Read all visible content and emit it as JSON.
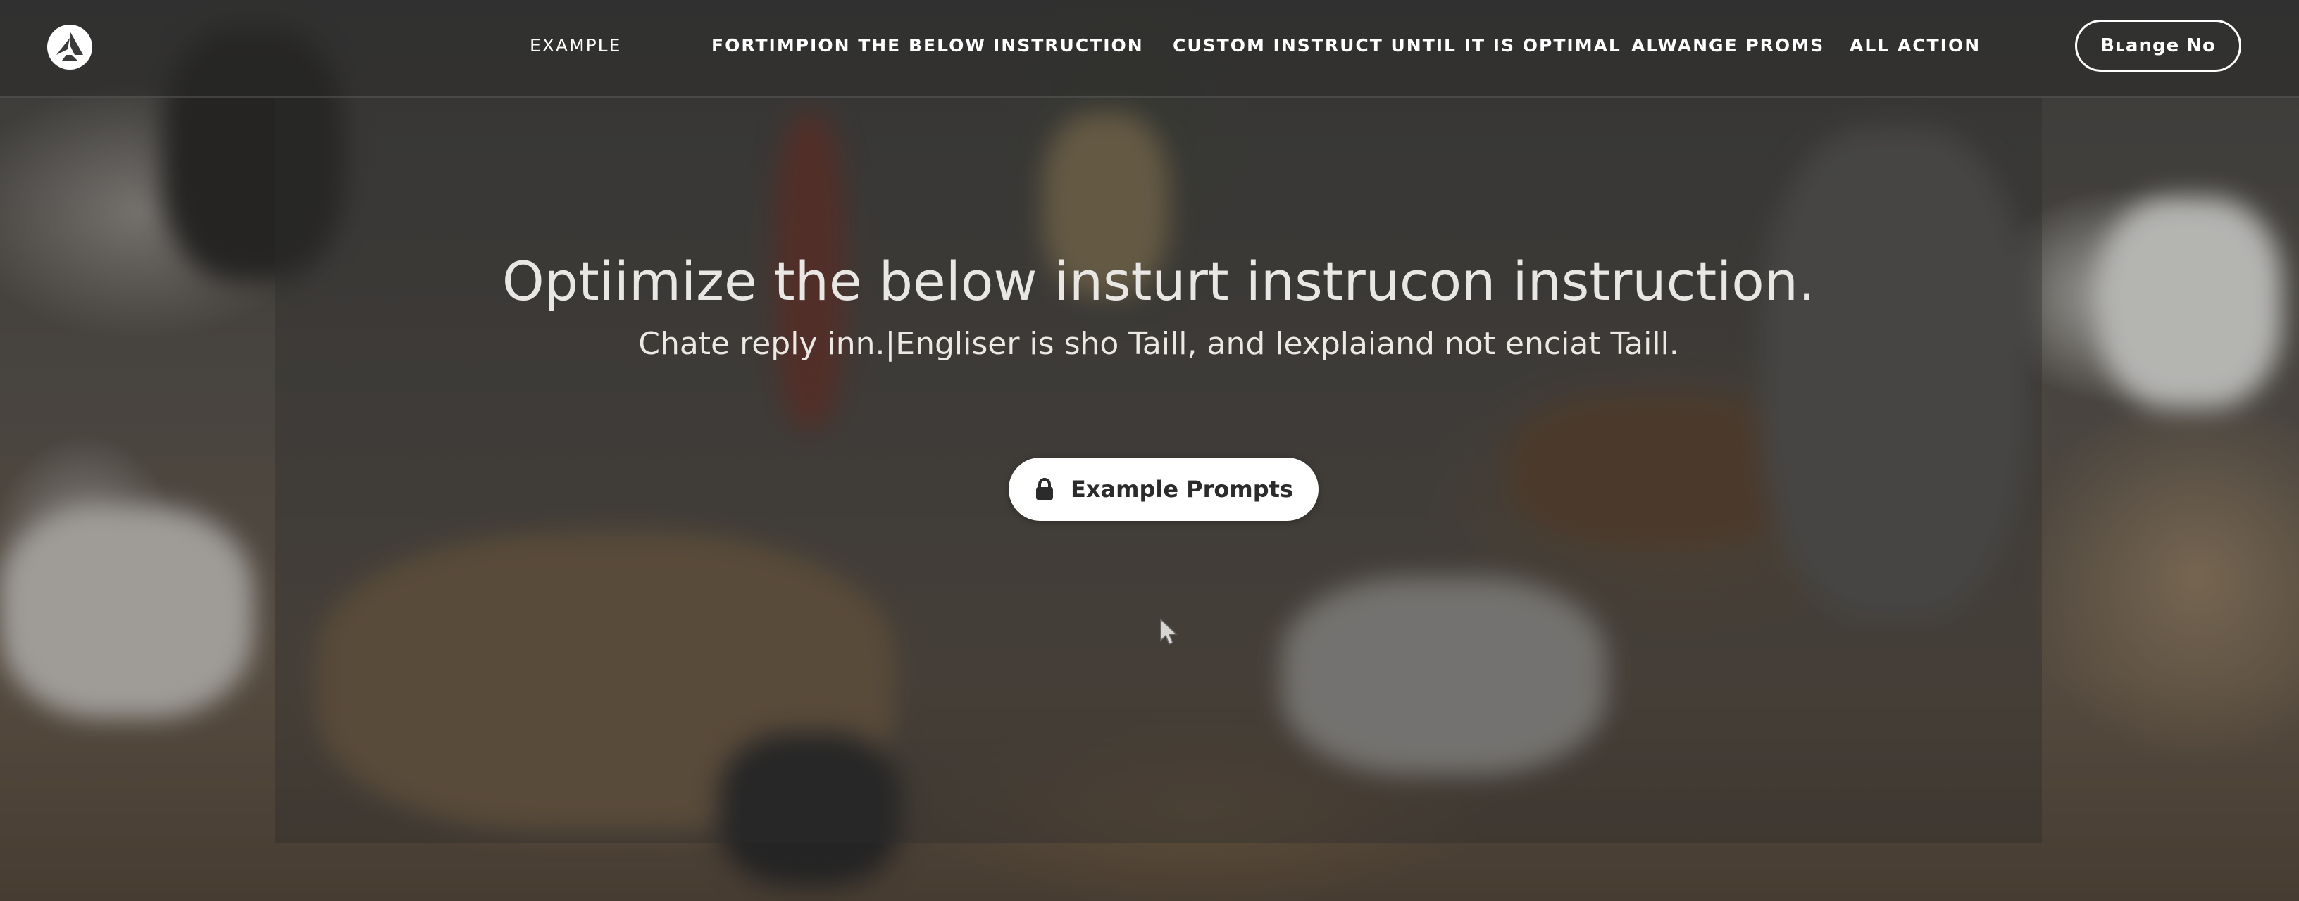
{
  "nav": {
    "logo_icon": "brand-logo-icon",
    "links": [
      {
        "label": "EXAMPLE"
      },
      {
        "label": "FORTIMPION THE BELOW"
      },
      {
        "label": "INSTRUCTION"
      },
      {
        "label": "CUSTOM INSTRUCT UNTIL IT IS OPTIMAL"
      },
      {
        "label": "ALWANGE PROMS"
      },
      {
        "label": "ALL ACTION"
      }
    ],
    "button_label": "Bʟange No"
  },
  "hero": {
    "title": "Optiimize the below insturt instrucon instruction.",
    "subtitle": "Chate reply inn.|Engliser is sho Taill, and lexplaiand not enciat Taill.",
    "cta_label": "Example Prompts",
    "cta_icon": "lock-icon"
  },
  "colors": {
    "nav_bg": "#282828",
    "text_light": "#ffffff",
    "cta_bg": "#ffffff",
    "cta_text": "#2b2b2b"
  }
}
